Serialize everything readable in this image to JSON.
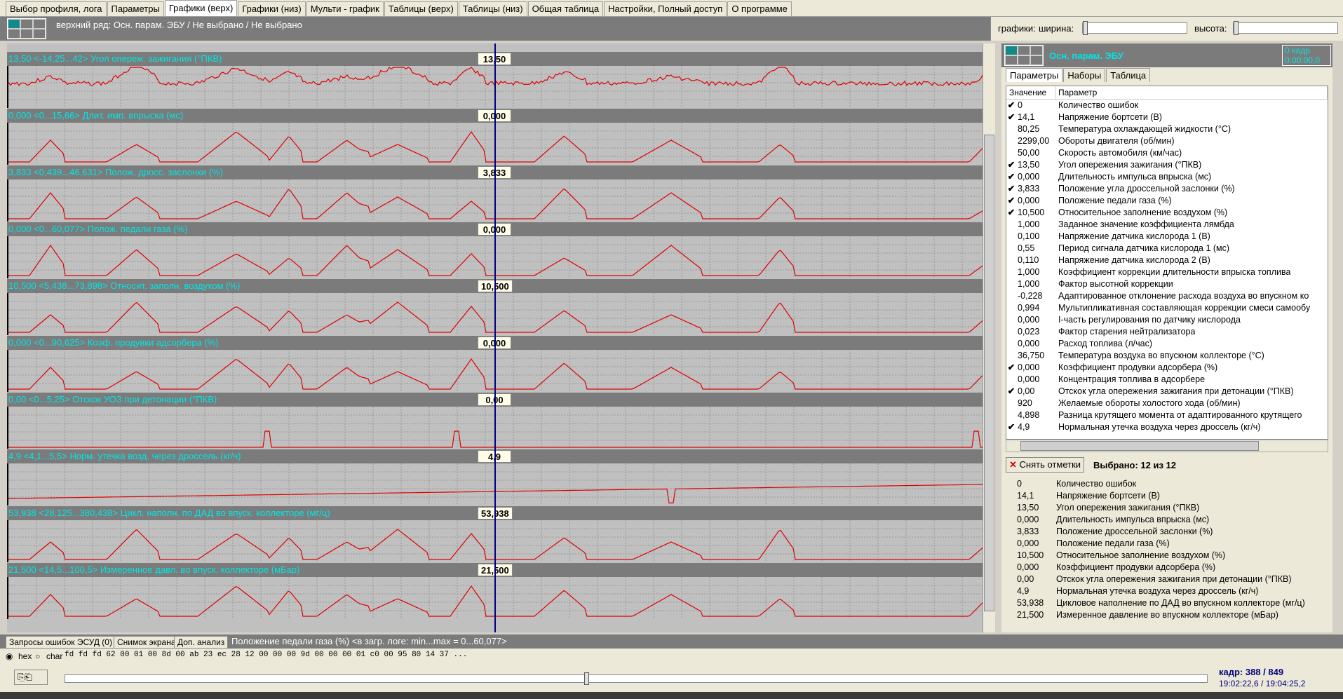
{
  "menu_tabs": [
    "Выбор профиля, лога",
    "Параметры",
    "Графики (верх)",
    "Графики (низ)",
    "Мульти - график",
    "Таблицы (верх)",
    "Таблицы (низ)",
    "Общая таблица",
    "Настройки, Полный доступ",
    "О программе"
  ],
  "top": {
    "row_label": "верхний ряд: Осн. парам. ЭБУ / Не выбрано / Не выбрано",
    "graphs_label": "графики:",
    "width_label": "ширина:",
    "height_label": "высота:"
  },
  "strips": [
    {
      "header": "13,50   <-14,25...42>  Угол опереж. зажигания (°ПКВ)",
      "cursor": "13,50"
    },
    {
      "header": "0,000   <0...15,66>  Длит. имп. впрыска (мс)",
      "cursor": "0,000"
    },
    {
      "header": "3,833   <0,439...46,631>  Полож. дросс. заслонки (%)",
      "cursor": "3,833"
    },
    {
      "header": "0,000   <0...60,077>  Полож. педали газа (%)",
      "cursor": "0,000"
    },
    {
      "header": "10,500   <5,438...73,898>  Относит. заполн. воздухом (%)",
      "cursor": "10,500"
    },
    {
      "header": "0,000   <0...90,625>  Коэф. продувки адсорбера (%)",
      "cursor": "0,000"
    },
    {
      "header": "0,00   <0...5,25>  Отскок УОЗ при детонации (°ПКВ)",
      "cursor": "0,00"
    },
    {
      "header": "4,9   <4,1...5,5>  Норм. утечка возд. через дроссель (кг/ч)",
      "cursor": "4,9"
    },
    {
      "header": "53,938   <28,125...380,438>  Цикл. наполн. по ДАД во впуск. коллекторе (мг/ц)",
      "cursor": "53,938"
    },
    {
      "header": "21,500   <14,5...100,5>  Измеренное давл. во впуск. коллекторе (мБар)",
      "cursor": "21,500"
    }
  ],
  "right": {
    "title": "Осн. парам. ЭБУ",
    "frame_line1": "0 кадр",
    "frame_line2": "0:00:00,0",
    "tabs": [
      "Параметры",
      "Наборы",
      "Таблица"
    ],
    "col_value": "Значение",
    "col_param": "Параметр",
    "rows": [
      {
        "c": true,
        "v": "0",
        "n": "Количество ошибок"
      },
      {
        "c": true,
        "v": "14,1",
        "n": "Напряжение бортсети (В)"
      },
      {
        "c": false,
        "v": "80,25",
        "n": "Температура охлаждающей жидкости (°С)"
      },
      {
        "c": false,
        "v": "2299,00",
        "n": "Обороты двигателя (об/мин)"
      },
      {
        "c": false,
        "v": "50,00",
        "n": "Скорость автомобиля (км/час)"
      },
      {
        "c": true,
        "v": "13,50",
        "n": "Угол опережения зажигания (°ПКВ)"
      },
      {
        "c": true,
        "v": "0,000",
        "n": "Длительность импульса впрыска (мс)"
      },
      {
        "c": true,
        "v": "3,833",
        "n": "Положение угла дроссельной заслонки (%)"
      },
      {
        "c": true,
        "v": "0,000",
        "n": "Положение педали газа (%)"
      },
      {
        "c": true,
        "v": "10,500",
        "n": "Относительное заполнение воздухом (%)"
      },
      {
        "c": false,
        "v": "1,000",
        "n": "Заданное значение коэффициента лямбда"
      },
      {
        "c": false,
        "v": "0,100",
        "n": "Напряжение датчика кислорода 1 (В)"
      },
      {
        "c": false,
        "v": "0,55",
        "n": "Период сигнала датчика кислорода 1 (мс)"
      },
      {
        "c": false,
        "v": "0,110",
        "n": "Напряжение датчика кислорода 2 (В)"
      },
      {
        "c": false,
        "v": "1,000",
        "n": "Коэффициент коррекции длительности впрыска топлива"
      },
      {
        "c": false,
        "v": "1,000",
        "n": "Фактор высотной коррекции"
      },
      {
        "c": false,
        "v": "-0,228",
        "n": "Адаптированное отклонение расхода воздуха во впускном ко"
      },
      {
        "c": false,
        "v": "0,994",
        "n": "Мультипликативная составляющая коррекции смеси самообу"
      },
      {
        "c": false,
        "v": "0,000",
        "n": "I-часть регулирования по датчику кислорода"
      },
      {
        "c": false,
        "v": "0,023",
        "n": "Фактор старения нейтрализатора"
      },
      {
        "c": false,
        "v": "0,000",
        "n": "Расход топлива (л/час)"
      },
      {
        "c": false,
        "v": "36,750",
        "n": "Температура воздуха во впускном коллекторе (°С)"
      },
      {
        "c": true,
        "v": "0,000",
        "n": "Коэффициент продувки адсорбера (%)"
      },
      {
        "c": false,
        "v": "0,000",
        "n": "Концентрация топлива в адсорбере"
      },
      {
        "c": true,
        "v": "0,00",
        "n": "Отскок угла опережения зажигания при детонации (°ПКВ)"
      },
      {
        "c": false,
        "v": "920",
        "n": "Желаемые обороты холостого хода (об/мин)"
      },
      {
        "c": false,
        "v": "4,898",
        "n": "Разница крутящего момента от адаптированного крутящего"
      },
      {
        "c": true,
        "v": "4,9",
        "n": "Нормальная утечка воздуха через дроссель (кг/ч)"
      }
    ],
    "clear_button": "Снять отметки",
    "selected": "Выбрано: 12 из 12",
    "values_list": [
      {
        "v": "0",
        "n": "Количество ошибок"
      },
      {
        "v": "14,1",
        "n": "Напряжение бортсети (В)"
      },
      {
        "v": "13,50",
        "n": "Угол опережения зажигания (°ПКВ)"
      },
      {
        "v": "0,000",
        "n": "Длительность импульса впрыска (мс)"
      },
      {
        "v": "3,833",
        "n": "Положение дроссельной заслонки (%)"
      },
      {
        "v": "0,000",
        "n": "Положение педали газа (%)"
      },
      {
        "v": "10,500",
        "n": "Относительное заполнение воздухом (%)"
      },
      {
        "v": "0,000",
        "n": "Коэффициент продувки адсорбера (%)"
      },
      {
        "v": "0,00",
        "n": "Отскок угла опережения зажигания при детонации (°ПКВ)"
      },
      {
        "v": "4,9",
        "n": "Нормальная утечка воздуха через дроссель (кг/ч)"
      },
      {
        "v": "53,938",
        "n": "Цикловое наполнение по ДАД во впускном коллекторе (мг/ц)"
      },
      {
        "v": "21,500",
        "n": "Измеренное давление во впускном коллекторе (мБар)"
      }
    ]
  },
  "bottom": {
    "tabs": [
      "Запросы ошибок ЭСУД (0)",
      "Снимок экрана",
      "Доп. анализ"
    ],
    "status": "Положение педали газа (%) <в загр. логе: min...max = 0...60,077>",
    "hex_label": "hex",
    "char_label": "char",
    "hex": "fd fd fd 62 00 01 00 8d 00 ab 23 ec 28 12 00 00 00 9d 00 00 00 01 c0 00 95 80 14 37 ...",
    "frame": "кадр: 388 / 849",
    "time": "19:02:22,6 / 19:04:25,2"
  },
  "colors": {
    "trace": "#e00000",
    "cursor": "#000080",
    "header_text": "#00e6e6",
    "panel": "#7b7b7b"
  }
}
